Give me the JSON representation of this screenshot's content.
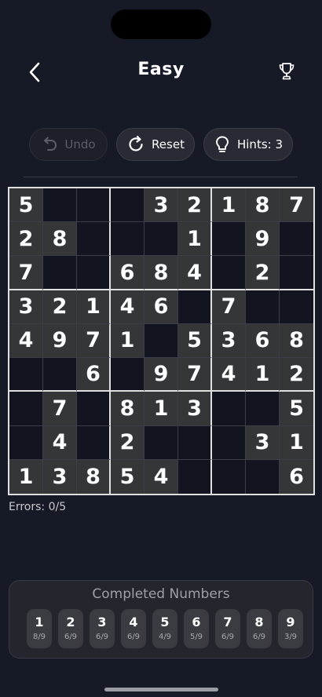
{
  "header": {
    "title": "Easy",
    "back_icon": "chevron-left-icon",
    "trophy_icon": "trophy-icon"
  },
  "toolbar": {
    "undo": {
      "label": "Undo",
      "icon": "undo-icon",
      "enabled": false
    },
    "reset": {
      "label": "Reset",
      "icon": "reset-icon",
      "enabled": true
    },
    "hints": {
      "label": "Hints: 3",
      "icon": "lightbulb-icon",
      "enabled": true
    }
  },
  "board": {
    "rows": [
      [
        "5",
        "",
        "",
        "",
        "3",
        "2",
        "1",
        "8",
        "7"
      ],
      [
        "2",
        "8",
        "",
        "",
        "",
        "1",
        "",
        "9",
        ""
      ],
      [
        "7",
        "",
        "",
        "6",
        "8",
        "4",
        "",
        "2",
        ""
      ],
      [
        "3",
        "2",
        "1",
        "4",
        "6",
        "",
        "7",
        "",
        ""
      ],
      [
        "4",
        "9",
        "7",
        "1",
        "",
        "5",
        "3",
        "6",
        "8"
      ],
      [
        "",
        "",
        "6",
        "",
        "9",
        "7",
        "4",
        "1",
        "2"
      ],
      [
        "",
        "7",
        "",
        "8",
        "1",
        "3",
        "",
        "",
        "5"
      ],
      [
        "",
        "4",
        "",
        "2",
        "",
        "",
        "",
        "3",
        "1"
      ],
      [
        "1",
        "3",
        "8",
        "5",
        "4",
        "",
        "",
        "",
        "6"
      ]
    ]
  },
  "status": {
    "errors": "Errors: 0/5"
  },
  "completed": {
    "title": "Completed Numbers",
    "numbers": [
      {
        "digit": "1",
        "count": "8/9"
      },
      {
        "digit": "2",
        "count": "6/9"
      },
      {
        "digit": "3",
        "count": "6/9"
      },
      {
        "digit": "4",
        "count": "6/9"
      },
      {
        "digit": "5",
        "count": "4/9"
      },
      {
        "digit": "6",
        "count": "5/9"
      },
      {
        "digit": "7",
        "count": "6/9"
      },
      {
        "digit": "8",
        "count": "6/9"
      },
      {
        "digit": "9",
        "count": "3/9"
      }
    ]
  },
  "colors": {
    "background": "#161a26",
    "given_cell": "#353638",
    "grid_line_major": "#e0e0e0"
  }
}
